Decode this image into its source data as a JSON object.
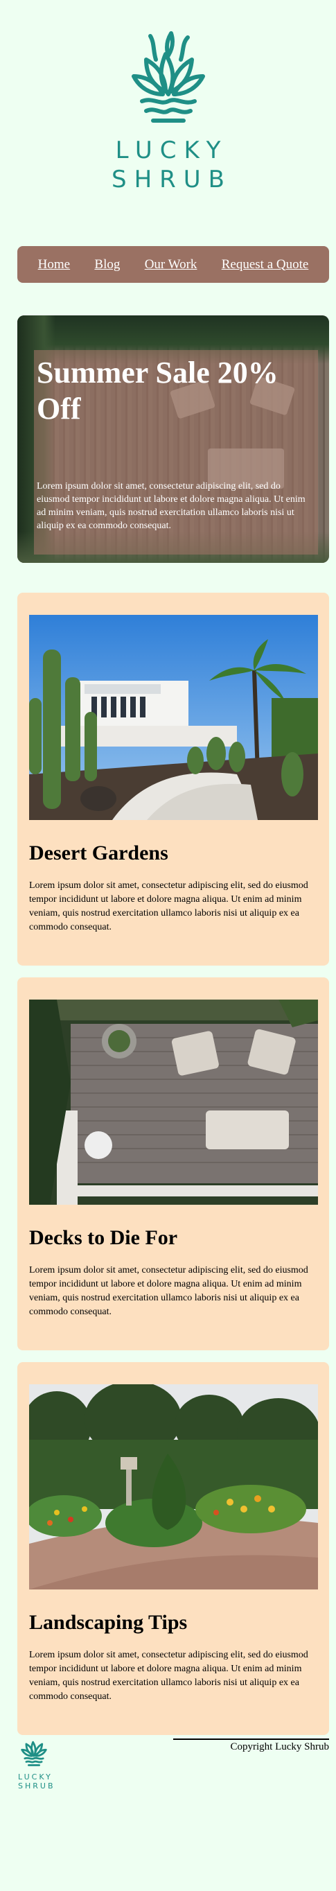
{
  "brand": {
    "logo_text_line1": "LUCKY",
    "logo_text_line2": "SHRUB",
    "color": "#1f8f86"
  },
  "nav": {
    "items": [
      {
        "label": "Home"
      },
      {
        "label": "Blog"
      },
      {
        "label": "Our Work"
      },
      {
        "label": "Request a Quote"
      }
    ],
    "background": "#9a7163"
  },
  "hero": {
    "title": "Summer Sale 20% Off",
    "text": "Lorem ipsum dolor sit amet, consectetur adipiscing elit, sed do eiusmod tempor incididunt ut labore et dolore magna aliqua. Ut enim ad minim veniam, quis nostrud exercitation ullamco laboris nisi ut aliquip ex ea commodo consequat."
  },
  "cards": [
    {
      "title": "Desert Gardens",
      "text": "Lorem ipsum dolor sit amet, consectetur adipiscing elit, sed do eiusmod tempor incididunt ut labore et dolore magna aliqua. Ut enim ad minim veniam, quis nostrud exercitation ullamco laboris nisi ut aliquip ex ea commodo consequat."
    },
    {
      "title": "Decks to Die For",
      "text": "Lorem ipsum dolor sit amet, consectetur adipiscing elit, sed do eiusmod tempor incididunt ut labore et dolore magna aliqua. Ut enim ad minim veniam, quis nostrud exercitation ullamco laboris nisi ut aliquip ex ea commodo consequat."
    },
    {
      "title": "Landscaping Tips",
      "text": "Lorem ipsum dolor sit amet, consectetur adipiscing elit, sed do eiusmod tempor incididunt ut labore et dolore magna aliqua. Ut enim ad minim veniam, quis nostrud exercitation ullamco laboris nisi ut aliquip ex ea commodo consequat."
    }
  ],
  "footer": {
    "copyright": "Copyright Lucky Shrub",
    "logo_text_line1": "LUCKY",
    "logo_text_line2": "SHRUB"
  },
  "colors": {
    "page_background": "#eefff2",
    "card_background": "#fde0c0",
    "accent_brown": "#9a7163"
  }
}
